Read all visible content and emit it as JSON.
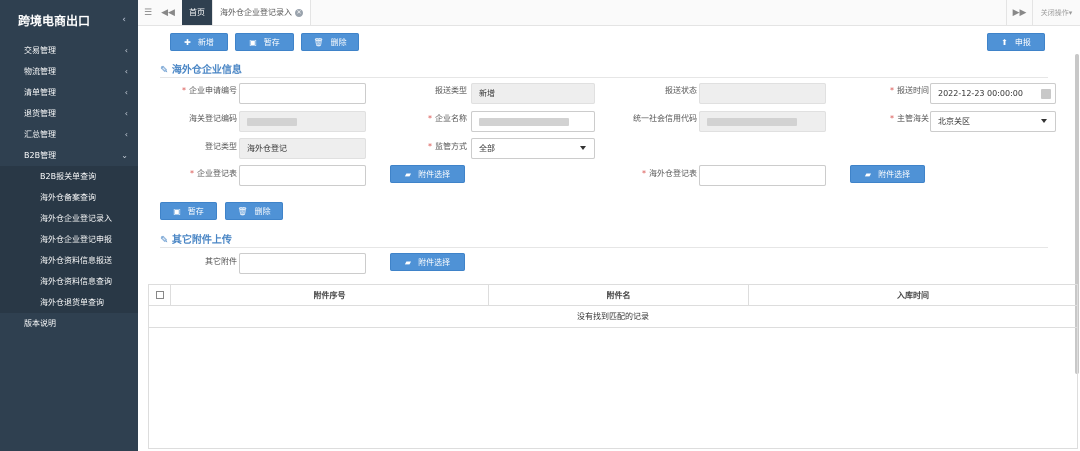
{
  "sidebar": {
    "title": "跨境电商出口",
    "items": [
      {
        "label": "交易管理"
      },
      {
        "label": "物流管理"
      },
      {
        "label": "清单管理"
      },
      {
        "label": "退货管理"
      },
      {
        "label": "汇总管理"
      },
      {
        "label": "B2B管理"
      }
    ],
    "subitems": [
      {
        "label": "B2B报关单查询"
      },
      {
        "label": "海外仓备案查询"
      },
      {
        "label": "海外仓企业登记录入"
      },
      {
        "label": "海外仓企业登记申报"
      },
      {
        "label": "海外仓资料信息报送"
      },
      {
        "label": "海外仓资料信息查询"
      },
      {
        "label": "海外仓退货单查询"
      }
    ],
    "footer_item": "版本说明"
  },
  "tabbar": {
    "home": "首页",
    "current": "海外仓企业登记录入",
    "close_ops": "关闭操作"
  },
  "toolbar": {
    "add": "新增",
    "save": "暂存",
    "delete": "删除",
    "declare": "申报"
  },
  "section1": {
    "title": "海外仓企业信息",
    "fields": {
      "apply_no": {
        "label": "企业申请编号",
        "value": ""
      },
      "report_type": {
        "label": "报送类型",
        "value": "新增"
      },
      "report_status": {
        "label": "报送状态",
        "value": ""
      },
      "report_time": {
        "label": "报送时间",
        "value": "2022-12-23 00:00:00"
      },
      "customs_code": {
        "label": "海关登记编码"
      },
      "company_name": {
        "label": "企业名称"
      },
      "credit_code": {
        "label": "统一社会信用代码"
      },
      "customs": {
        "label": "主管海关",
        "value": "北京关区"
      },
      "reg_type": {
        "label": "登记类型",
        "value": "海外仓登记"
      },
      "supervision": {
        "label": "监管方式",
        "value": "全部"
      },
      "company_form": {
        "label": "企业登记表"
      },
      "warehouse_form": {
        "label": "海外仓登记表"
      }
    },
    "attach_btn": "附件选择",
    "save": "暂存",
    "delete": "删除"
  },
  "section2": {
    "title": "其它附件上传",
    "other_label": "其它附件",
    "attach_btn": "附件选择"
  },
  "table": {
    "columns": [
      "附件序号",
      "附件名",
      "入库时间"
    ],
    "empty": "没有找到匹配的记录"
  }
}
